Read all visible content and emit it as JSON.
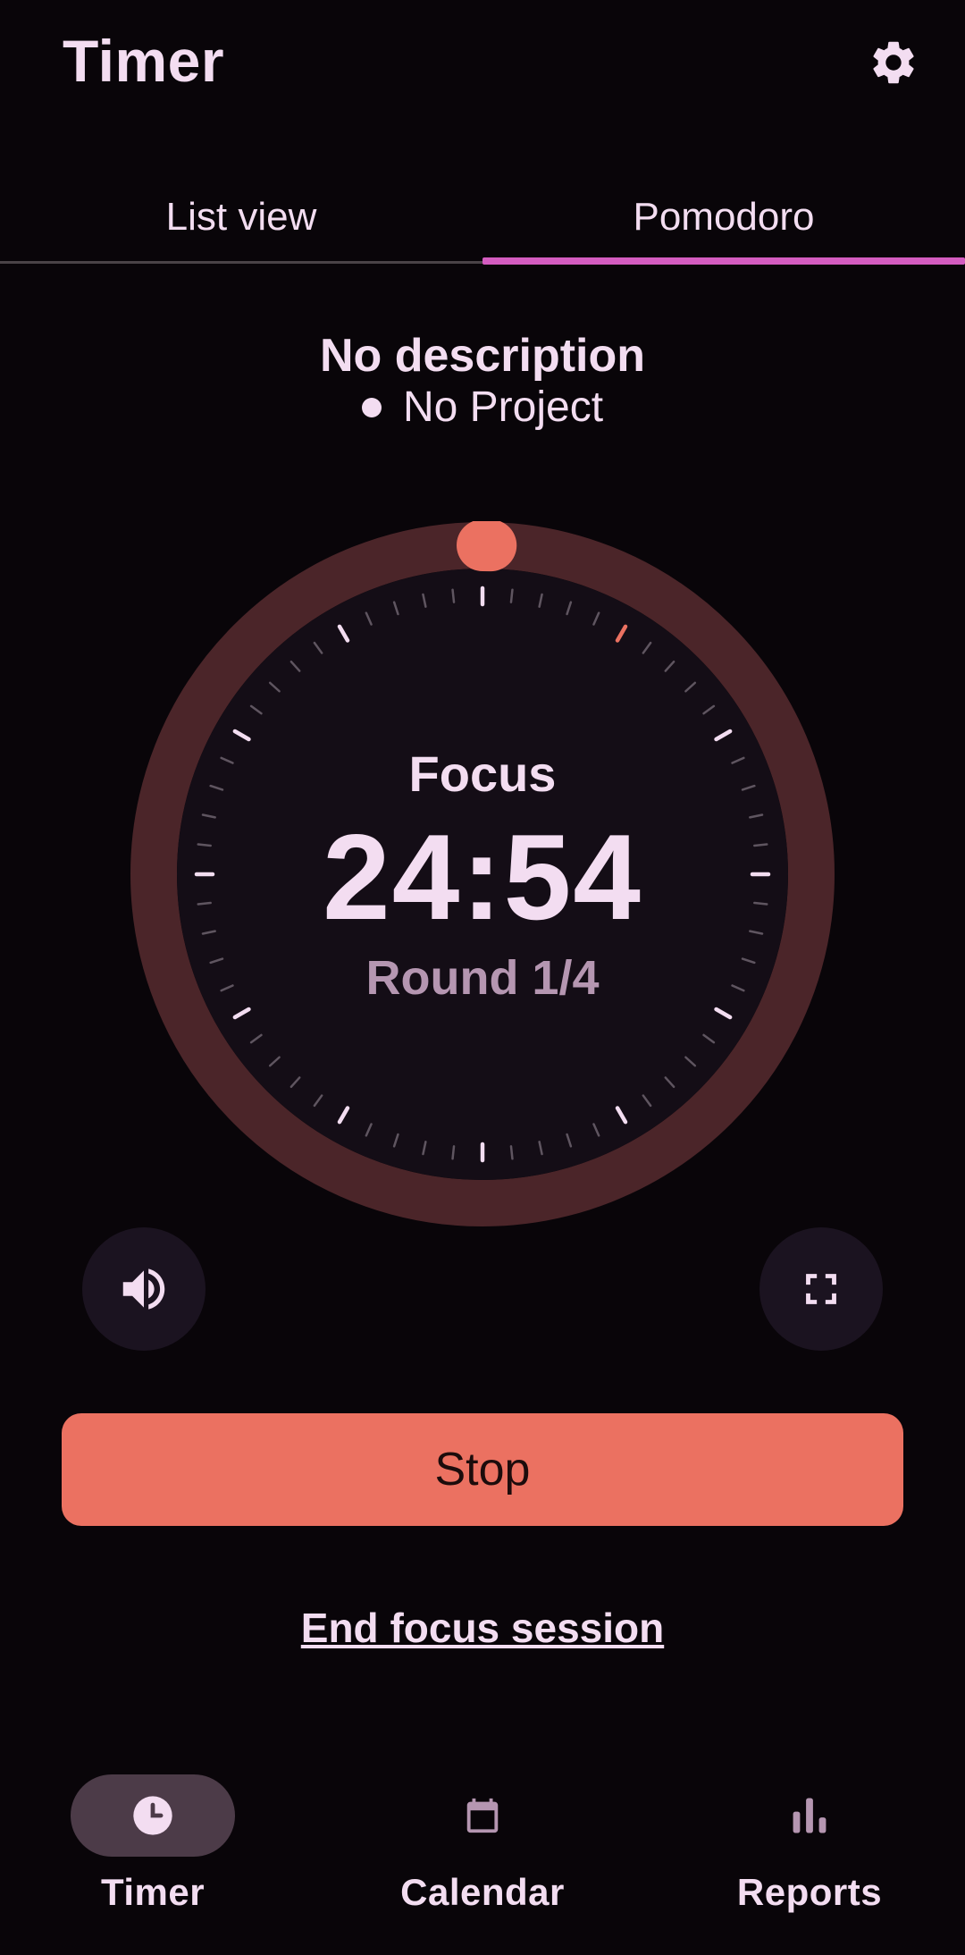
{
  "header": {
    "title": "Timer",
    "settings_icon": "gear-icon"
  },
  "tabs": [
    {
      "label": "List view",
      "selected": false
    },
    {
      "label": "Pomodoro",
      "selected": true
    }
  ],
  "entry": {
    "description": "No description",
    "project": "No Project"
  },
  "timer": {
    "phase": "Focus",
    "remaining": "24:54",
    "round": "Round 1/4",
    "progress_fraction": 0.004
  },
  "controls": {
    "volume_icon": "volume-icon",
    "fullscreen_icon": "fullscreen-icon",
    "stop_label": "Stop",
    "end_session_label": "End focus session"
  },
  "bottom_nav": [
    {
      "label": "Timer",
      "icon": "clock-icon",
      "selected": true
    },
    {
      "label": "Calendar",
      "icon": "calendar-icon",
      "selected": false
    },
    {
      "label": "Reports",
      "icon": "bar-chart-icon",
      "selected": false
    }
  ],
  "colors": {
    "background": "#090509",
    "accent": "#eb7161",
    "tab_indicator": "#d45cc0",
    "ring_track": "#4b2529",
    "dial_face": "#140d16",
    "text_primary": "#f3ddf1",
    "text_secondary": "#b596b1"
  }
}
